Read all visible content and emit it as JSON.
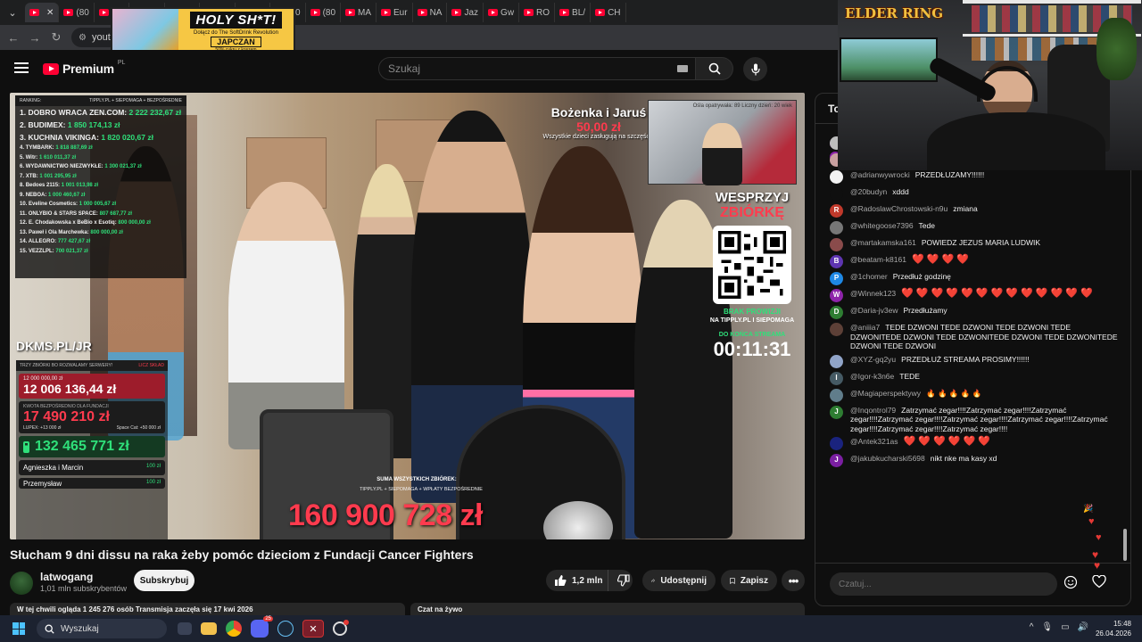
{
  "browser": {
    "tabs": [
      {
        "label": "",
        "active": true,
        "favicon": "red"
      },
      {
        "label": "(80",
        "favicon": "red"
      },
      {
        "label": "(80",
        "favicon": "red"
      },
      {
        "label": "(80",
        "favicon": "red"
      },
      {
        "label": "(80",
        "favicon": "red"
      },
      {
        "label": "(80",
        "favicon": "red"
      },
      {
        "label": "(80",
        "favicon": "red"
      },
      {
        "label": "(80",
        "favicon": "red"
      },
      {
        "label": "(80",
        "favicon": "red"
      },
      {
        "label": "MA",
        "favicon": "red"
      },
      {
        "label": "Eur",
        "favicon": "red"
      },
      {
        "label": "NA",
        "favicon": "red"
      },
      {
        "label": "Jaz",
        "favicon": "red"
      },
      {
        "label": "Gw",
        "favicon": "red"
      },
      {
        "label": "RO",
        "favicon": "red"
      },
      {
        "label": "BL/",
        "favicon": "red"
      },
      {
        "label": "CH",
        "favicon": "red"
      }
    ],
    "url": "yout"
  },
  "ad": {
    "headline": "HOLY SH*T!",
    "sub": "Dołącz do The SoftDrink Revolution",
    "brand": "JAPCZAN",
    "small": "50% cukru z koszem"
  },
  "youtube": {
    "logo_text": "Premium",
    "region": "PL",
    "search_placeholder": "Szukaj"
  },
  "stream": {
    "ranking_title": "RANKING:",
    "ranking_source": "TIPPLY.PL + SIEPOMAGA + BEZPOŚREDNIE",
    "ranking": [
      {
        "rank": "1.",
        "name": "DOBRO WRACA ZEN.COM:",
        "value": "2 222 232,67 zł",
        "size": "big"
      },
      {
        "rank": "2.",
        "name": "BUDIMEX:",
        "value": "1 850 174,13 zł",
        "size": "big"
      },
      {
        "rank": "3.",
        "name": "KUCHNIA VIKINGA:",
        "value": "1 820 020,67 zł",
        "size": "big"
      },
      {
        "rank": "4.",
        "name": "TYMBARK:",
        "value": "1 818 887,69 zł",
        "size": "small"
      },
      {
        "rank": "5.",
        "name": "Witr:",
        "value": "1 610 011,37 zł",
        "size": "small"
      },
      {
        "rank": "6.",
        "name": "WYDAWNICTWO NIEZWYKŁE:",
        "value": "1 300 021,37 zł",
        "size": "small"
      },
      {
        "rank": "7.",
        "name": "XTB:",
        "value": "1 001 295,95 zł",
        "size": "small"
      },
      {
        "rank": "8.",
        "name": "Bedoes 2115:",
        "value": "1 001 013,98 zł",
        "size": "small"
      },
      {
        "rank": "9.",
        "name": "NEBOA:",
        "value": "1 000 460,67 zł",
        "size": "small"
      },
      {
        "rank": "10.",
        "name": "Eveline Cosmetics:",
        "value": "1 000 005,67 zł",
        "size": "small"
      },
      {
        "rank": "11.",
        "name": "ONLYBIO & STARS SPACE:",
        "value": "807 687,77 zł",
        "size": "small"
      },
      {
        "rank": "12.",
        "name": "E. Chodakowska x BeBio x Esotiq:",
        "value": "800 000,00 zł",
        "size": "small"
      },
      {
        "rank": "13.",
        "name": "Paweł i Ola Marchewka:",
        "value": "800 000,00 zł",
        "size": "small"
      },
      {
        "rank": "14.",
        "name": "ALLEGRO:",
        "value": "777 427,67 zł",
        "size": "small"
      },
      {
        "rank": "15.",
        "name": "VEZZLPL:",
        "value": "700 021,37 zł",
        "size": "small"
      }
    ],
    "dkms": "DKMS.PL/JR",
    "panel_header_left": "TRZY ZBIÓRKI BO ROZWALAMY SERWERY!",
    "panel_header_right": "LICZ SKŁAD",
    "goal_small": "12 000 000,00 zł",
    "goal_big": "12 006 136,44 zł",
    "direct_label": "KWOTA BEZPOŚREDNIO DLA FUNDACJI",
    "direct_amount": "17 490 210 zł",
    "direct_meta_1": "LUPEX: +13 000 zł",
    "direct_meta_2": "Space Cat: +50 000 zł",
    "green_total": "132 465 771 zł",
    "name_row_1": "Agnieszka i Marcin",
    "name_row_1_value": "100 zł",
    "name_row_2": "Przemysław",
    "name_row_2_value": "100 zł",
    "donation_name": "Bożenka i Jaruś",
    "donation_amount": "50,00 zł",
    "donation_msg": "Wszystkie dzieci zasługują na szczęście",
    "insert_text": "Ośla opatrywała: 89 Liczny dzień: 20 wiek",
    "support_title_1": "WESPRZYJ",
    "support_title_2": "ZBIÓRKĘ",
    "no_fee": "BRAK PROWIZJI",
    "no_fee_sub": "NA TIPPLY.PL I SIEPOMAGA",
    "until_end": "DO KOŃCA STREAMA",
    "timer": "00:11:31",
    "sum_label": "SUMA WSZYSTKICH ZBIÓREK:",
    "sum_sub": "TIPPLY.PL + SIEPOMAGA + WPŁATY BEZPOŚREDNIE",
    "sum_total": "160 900 728 zł"
  },
  "video": {
    "title": "Słucham 9 dni dissu na raka żeby pomóc dzieciom z Fundacji Cancer Fighters",
    "channel": "latwogang",
    "subscribers": "1,01 mln subskrybentów",
    "subscribe_label": "Subskrybuj",
    "likes": "1,2 mln",
    "share_label": "Udostępnij",
    "save_label": "Zapisz",
    "info_line": "W tej chwili ogląda 1 245 276 osób  Transmisja zaczęła się 17 kwi 2026",
    "chat_replay": "Czat na żywo"
  },
  "chat": {
    "header": "To",
    "input_placeholder": "Czatuj...",
    "messages": [
      {
        "user": "@magdakupiecka7678",
        "text": "PRZEDŁUŻAMY DO PÓŁNOCY!!",
        "avatar_color": "#bdbdbd",
        "initial": ""
      },
      {
        "user": "@nycz6",
        "text": "zmiana",
        "avatar_color": "#c9a0a0",
        "initial": ""
      },
      {
        "user": "@adrianwywrocki",
        "text": "PRZEDŁUZAMY!!!!!!",
        "avatar_color": "#f1f1f1",
        "initial": ""
      },
      {
        "user": "@20budyn",
        "text": "xddd",
        "avatar_color": "#0f0f0f",
        "initial": ""
      },
      {
        "user": "@RadoslawChrostowski-n9u",
        "text": "zmiana",
        "avatar_color": "#c0392b",
        "initial": "R"
      },
      {
        "user": "@whitegoose7396",
        "text": "Tede",
        "avatar_color": "#777777",
        "initial": ""
      },
      {
        "user": "@martakamska161",
        "text": "POWIEDZ JEZUS MARIA LUDWIK",
        "avatar_color": "#8a4b4b",
        "initial": ""
      },
      {
        "user": "@beatam-k8161",
        "text": "❤️ ❤️ ❤️ ❤️",
        "avatar_color": "#5e35b1",
        "initial": "B"
      },
      {
        "user": "@1chomer",
        "text": "Przedłuż godzinę",
        "avatar_color": "#1e88e5",
        "initial": "P"
      },
      {
        "user": "@Winnek123",
        "text": "❤️ ❤️ ❤️ ❤️ ❤️ ❤️ ❤️ ❤️ ❤️ ❤️ ❤️ ❤️ ❤️",
        "avatar_color": "#8e24aa",
        "initial": "W"
      },
      {
        "user": "@Daria-jv3ew",
        "text": "Przedłużamy",
        "avatar_color": "#2e7d32",
        "initial": "D"
      },
      {
        "user": "@aniiia7",
        "text": "TEDE DZWONI TEDE DZWONI TEDE DZWONI TEDE DZWONITEDE DZWONI TEDE DZWONITEDE DZWONI TEDE DZWONITEDE DZWONI TEDE DZWONI",
        "avatar_color": "#5d4037",
        "initial": ""
      },
      {
        "user": "@XYZ-gq2yu",
        "text": "PRZEDŁUŻ STREAMA PROSIMY!!!!!!",
        "avatar_color": "#90a4c8",
        "initial": ""
      },
      {
        "user": "@Igor-k3n6e",
        "text": "TEDE",
        "avatar_color": "#455a64",
        "initial": "I"
      },
      {
        "user": "@Magiaperspektywy",
        "text": "🔥 🔥 🔥 🔥 🔥",
        "avatar_color": "#607d8b",
        "initial": ""
      },
      {
        "user": "@Inqontrol79",
        "text": "Zatrzymać zegar!!!!Zatrzymać zegar!!!!Zatrzymać zegar!!!!Zatrzymać zegar!!!!Zatrzymać zegar!!!!Zatrzymać zegar!!!!Zatrzymać zegar!!!!Zatrzymać zegar!!!!Zatrzymać zegar!!!!",
        "avatar_color": "#2e7d32",
        "initial": "J"
      },
      {
        "user": "@Antek321as",
        "text": "❤️ ❤️ ❤️ ❤️ ❤️ ❤️",
        "avatar_color": "#1a237e",
        "initial": ""
      },
      {
        "user": "@jakubkucharski5698",
        "text": "nikt nke ma kasy xd",
        "avatar_color": "#7b1fa2",
        "initial": "J"
      }
    ]
  },
  "webcam": {
    "poster_text": "ELDER RING"
  },
  "taskbar": {
    "search_label": "Wyszukaj",
    "time": "15:48",
    "date": "26.04.2026",
    "discord_badge": "25"
  },
  "colors": {
    "yt_red": "#ff0033",
    "overlay_green": "#2fe07a",
    "overlay_red": "#ff3b4e"
  }
}
